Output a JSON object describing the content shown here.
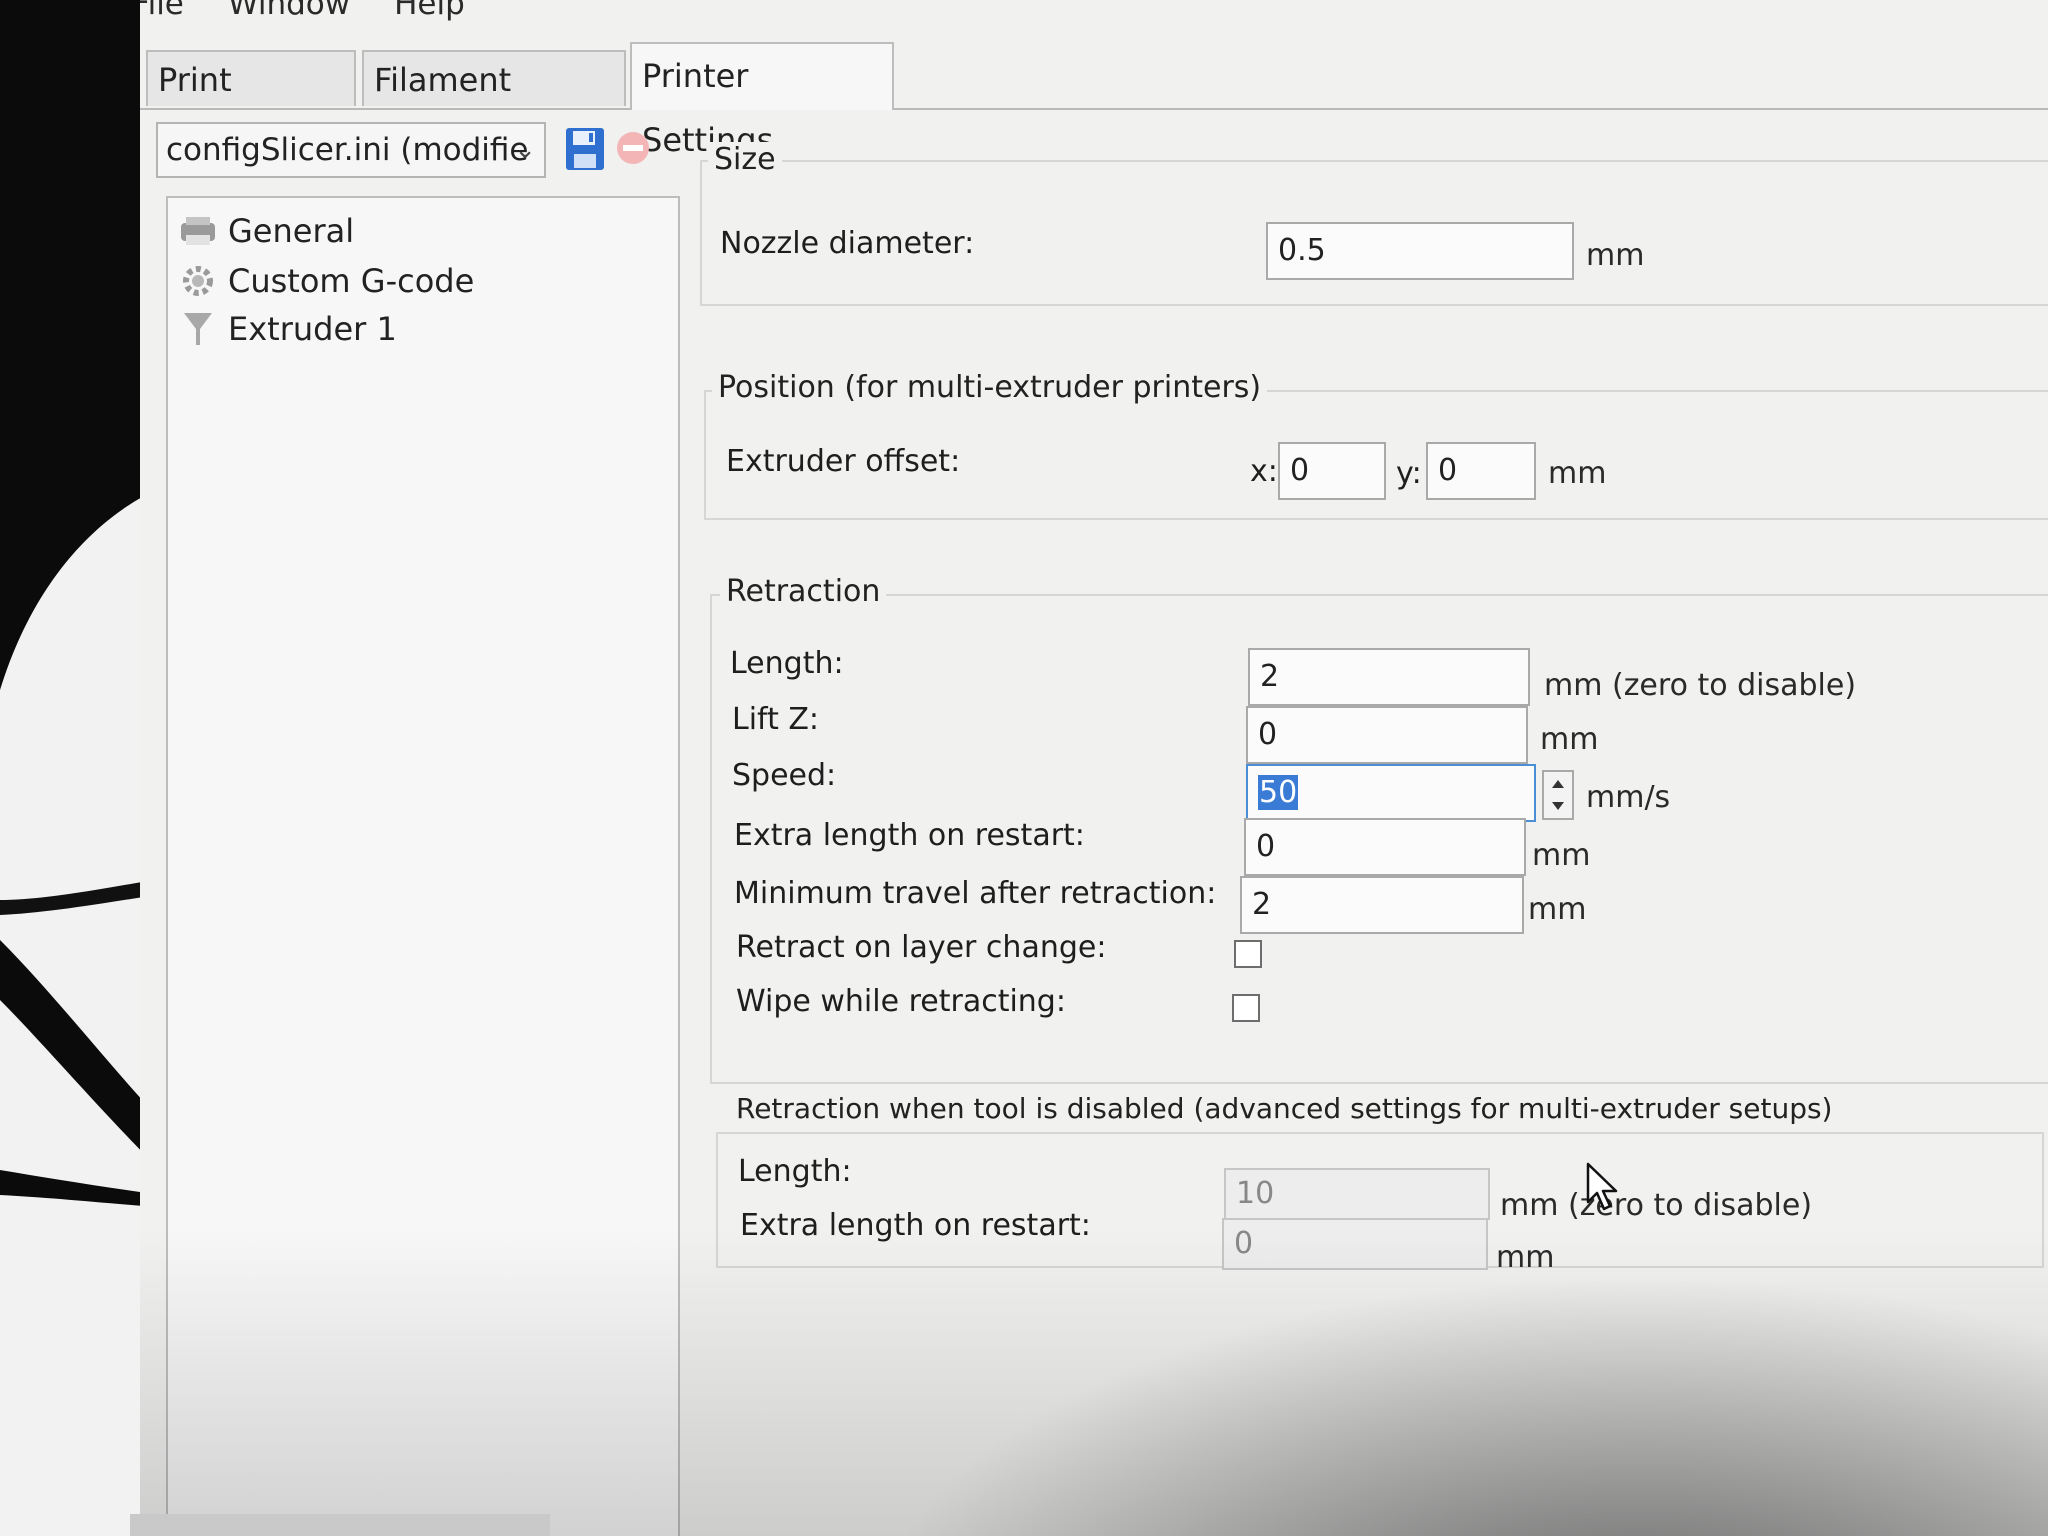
{
  "menu": {
    "file": "File",
    "window": "Window",
    "help": "Help"
  },
  "tabs": [
    {
      "label": "Print Settings",
      "active": false
    },
    {
      "label": "Filament Settings",
      "active": false
    },
    {
      "label": "Printer Settings",
      "active": true
    }
  ],
  "preset": {
    "value": "configSlicer.ini (modifie"
  },
  "tree": {
    "items": [
      {
        "label": "General",
        "icon": "printer-icon"
      },
      {
        "label": "Custom G-code",
        "icon": "gear-icon"
      },
      {
        "label": "Extruder 1",
        "icon": "funnel-icon"
      }
    ]
  },
  "size": {
    "title": "Size",
    "nozzle_label": "Nozzle diameter:",
    "nozzle_value": "0.5",
    "nozzle_unit": "mm"
  },
  "position": {
    "title": "Position (for multi-extruder printers)",
    "offset_label": "Extruder offset:",
    "x_label": "x:",
    "x_value": "0",
    "y_label": "y:",
    "y_value": "0",
    "unit": "mm"
  },
  "retraction": {
    "title": "Retraction",
    "length_label": "Length:",
    "length_value": "2",
    "length_unit": "mm (zero to disable)",
    "lift_label": "Lift Z:",
    "lift_value": "0",
    "lift_unit": "mm",
    "speed_label": "Speed:",
    "speed_value": "50",
    "speed_unit": "mm/s",
    "extra_label": "Extra length on restart:",
    "extra_value": "0",
    "extra_unit": "mm",
    "mintravel_label": "Minimum travel after retraction:",
    "mintravel_value": "2",
    "mintravel_unit": "mm",
    "layerchange_label": "Retract on layer change:",
    "layerchange_checked": false,
    "wipe_label": "Wipe while retracting:",
    "wipe_checked": false
  },
  "retraction_disabled": {
    "title": "Retraction when tool is disabled (advanced settings for multi-extruder setups)",
    "length_label": "Length:",
    "length_value": "10",
    "length_unit": "mm (zero to disable)",
    "extra_label": "Extra length on restart:",
    "extra_value": "0",
    "extra_unit": "mm"
  },
  "colors": {
    "window_bg": "#f1f1f0",
    "accent_blue": "#3a7bd5",
    "save_icon_blue": "#2f6fd0",
    "delete_icon_red": "#e57373"
  }
}
